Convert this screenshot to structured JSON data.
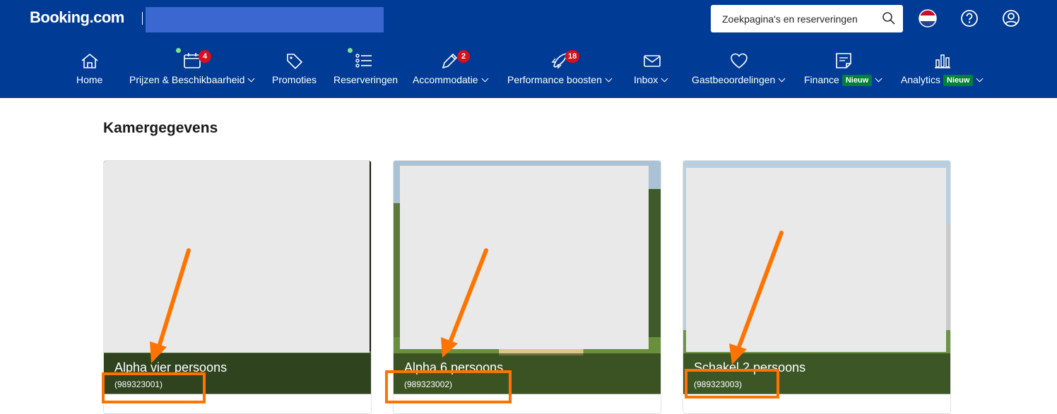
{
  "header": {
    "logo": "Booking.com",
    "search_placeholder": "Zoekpagina's en reserveringen"
  },
  "nav": [
    {
      "label": "Home",
      "icon": "home-icon"
    },
    {
      "label": "Prijzen & Beschikbaarheid",
      "icon": "calendar-icon",
      "badge": "4"
    },
    {
      "label": "Promoties",
      "icon": "tag-icon"
    },
    {
      "label": "Reserveringen",
      "icon": "list-icon"
    },
    {
      "label": "Accommodatie",
      "icon": "pencil-icon",
      "badge": "2"
    },
    {
      "label": "Performance boosten",
      "icon": "rocket-icon",
      "badge": "18"
    },
    {
      "label": "Inbox",
      "icon": "envelope-icon"
    },
    {
      "label": "Gastbeoordelingen",
      "icon": "heart-icon"
    },
    {
      "label": "Finance",
      "icon": "receipt-icon",
      "tag": "Nieuw"
    },
    {
      "label": "Analytics",
      "icon": "bar-chart-icon",
      "tag": "Nieuw"
    }
  ],
  "main": {
    "title": "Kamergegevens",
    "rooms": [
      {
        "name": "Alpha vier persoons",
        "id": "(989323001)"
      },
      {
        "name": "Alpha 6 persoons",
        "id": "(989323002)"
      },
      {
        "name": "Schakel 2 persoons",
        "id": "(989323003)"
      }
    ]
  },
  "colors": {
    "header_bg": "#003b95",
    "badge": "#d4111e",
    "new_badge": "#008234",
    "annotation": "#ff7400"
  }
}
